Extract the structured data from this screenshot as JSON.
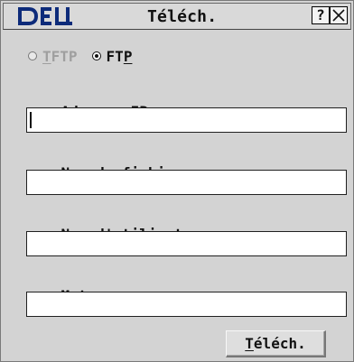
{
  "window": {
    "title": "Téléch.",
    "brand_text": "DELL",
    "help_label": "?"
  },
  "protocol": {
    "options": [
      {
        "prefix": "",
        "accesskey": "T",
        "suffix": "FTP",
        "disabled": true,
        "selected": false
      },
      {
        "prefix": "FT",
        "accesskey": "P",
        "suffix": "",
        "disabled": false,
        "selected": true
      }
    ]
  },
  "fields": {
    "ip": {
      "label_prefix": "Adresse ",
      "label_accesskey": "I",
      "label_suffix": "P :",
      "value": "",
      "focused": true
    },
    "filename": {
      "label_prefix": "Nom de ",
      "label_accesskey": "f",
      "label_suffix": "ichier  :",
      "value": ""
    },
    "username": {
      "label_prefix": "",
      "label_accesskey": "N",
      "label_suffix": "om d'utilisateur  :",
      "value": ""
    },
    "password": {
      "label_prefix": "",
      "label_accesskey": "M",
      "label_suffix": "ot passe :",
      "value": ""
    }
  },
  "actions": {
    "download": {
      "label_accesskey": "T",
      "label_suffix": "éléch."
    }
  },
  "colors": {
    "window_bg": "#d3d3d3",
    "brand_blue": "#0d2b7a",
    "disabled_text": "#9f9f9f"
  },
  "icons": {
    "brand": "dell-logo",
    "help": "question-mark-icon",
    "close": "close-x-icon",
    "radio_off": "radio-unselected-icon",
    "radio_on": "radio-selected-icon"
  }
}
